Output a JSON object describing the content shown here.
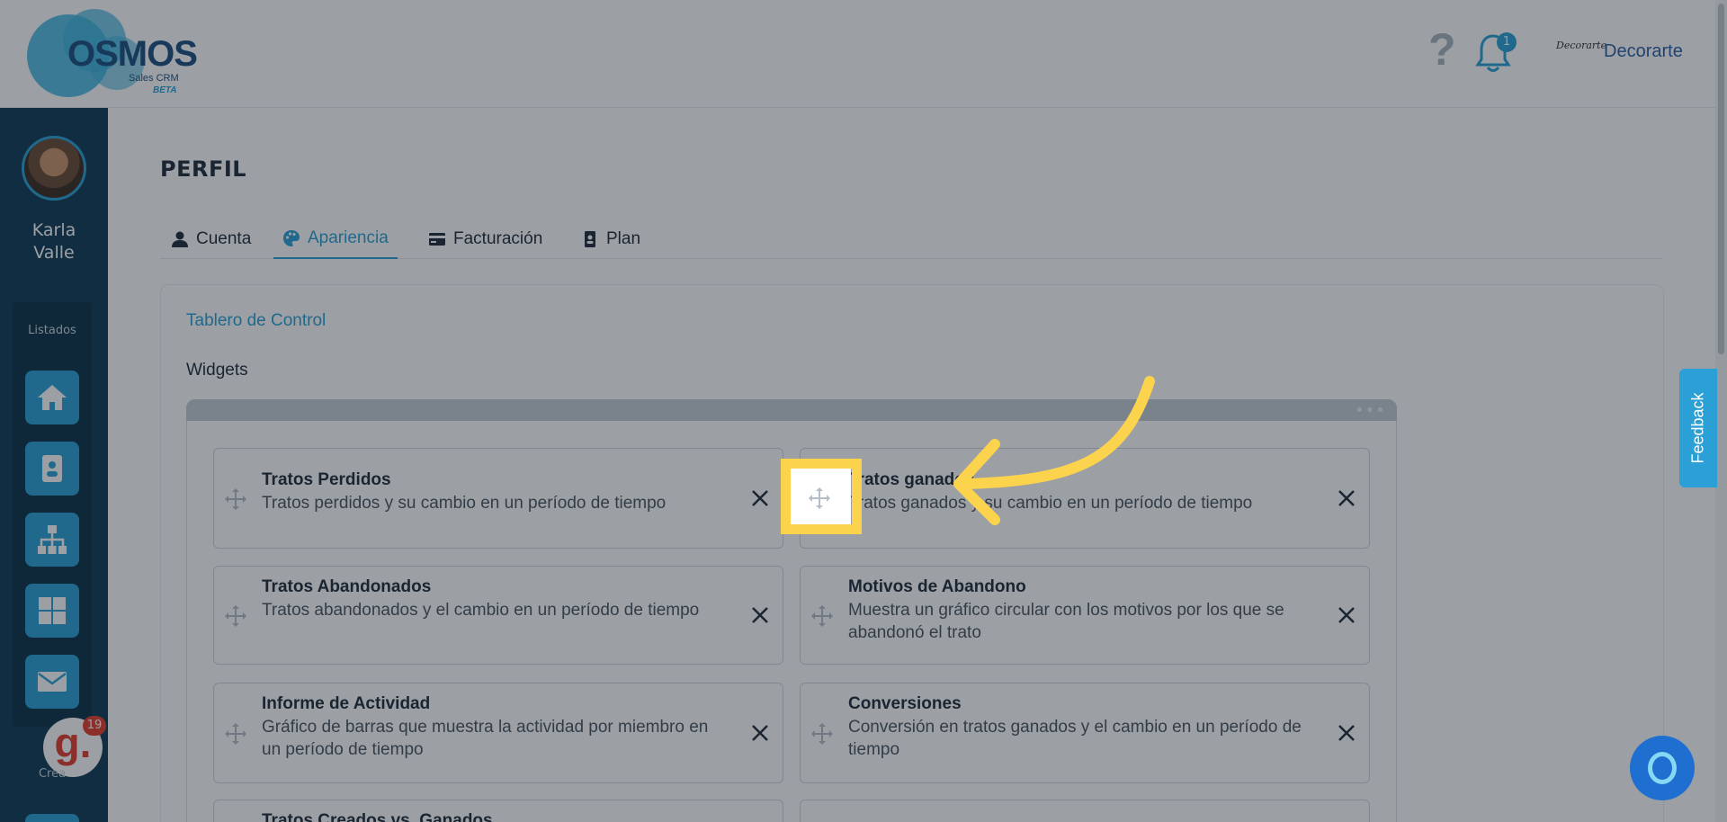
{
  "header": {
    "logo_text": "OSMOS",
    "logo_subtitle": "Sales CRM",
    "logo_beta": "BETA",
    "help_icon": "question-mark-icon",
    "notifications": {
      "icon": "bell-icon",
      "count": "1"
    },
    "brand_logo_text": "Decorarte",
    "brand_name": "Decorarte"
  },
  "sidebar": {
    "user_name_line1": "Karla",
    "user_name_line2": "Valle",
    "section_label": "Listados",
    "items": [
      {
        "icon": "home-icon"
      },
      {
        "icon": "contact-card-icon"
      },
      {
        "icon": "org-chart-icon"
      },
      {
        "icon": "dashboard-grid-icon"
      },
      {
        "icon": "mail-icon"
      }
    ],
    "badge_letter": "g.",
    "badge_count": "19",
    "bottom_label": "Crea"
  },
  "page": {
    "title": "PERFIL",
    "tabs": [
      {
        "label": "Cuenta",
        "icon": "user-icon",
        "active": false
      },
      {
        "label": "Apariencia",
        "icon": "palette-icon",
        "active": true
      },
      {
        "label": "Facturación",
        "icon": "credit-card-icon",
        "active": false
      },
      {
        "label": "Plan",
        "icon": "id-badge-icon",
        "active": false
      }
    ],
    "section_link": "Tablero de Control",
    "section_subtitle": "Widgets",
    "dots": "•••",
    "widgets": [
      {
        "title": "Tratos Perdidos",
        "desc": "Tratos perdidos y su cambio en un período de tiempo"
      },
      {
        "title": "Tratos ganados",
        "desc": "Tratos ganados y su cambio en un período de tiempo"
      },
      {
        "title": "Tratos Abandonados",
        "desc": "Tratos abandonados y el cambio en un período de tiempo"
      },
      {
        "title": "Motivos de Abandono",
        "desc": "Muestra un gráfico circular con los motivos por los que se abandonó el trato"
      },
      {
        "title": "Informe de Actividad",
        "desc": "Gráfico de barras que muestra la actividad por miembro en un período de tiempo"
      },
      {
        "title": "Conversiones",
        "desc": "Conversión en tratos ganados y el cambio en un período de tiempo"
      },
      {
        "title": "Tratos Creados vs. Ganados",
        "desc": ""
      }
    ]
  },
  "feedback_label": "Feedback",
  "colors": {
    "accent": "#2aa0d6",
    "sidebar": "#0f3a55",
    "highlight": "#fcd34d"
  }
}
